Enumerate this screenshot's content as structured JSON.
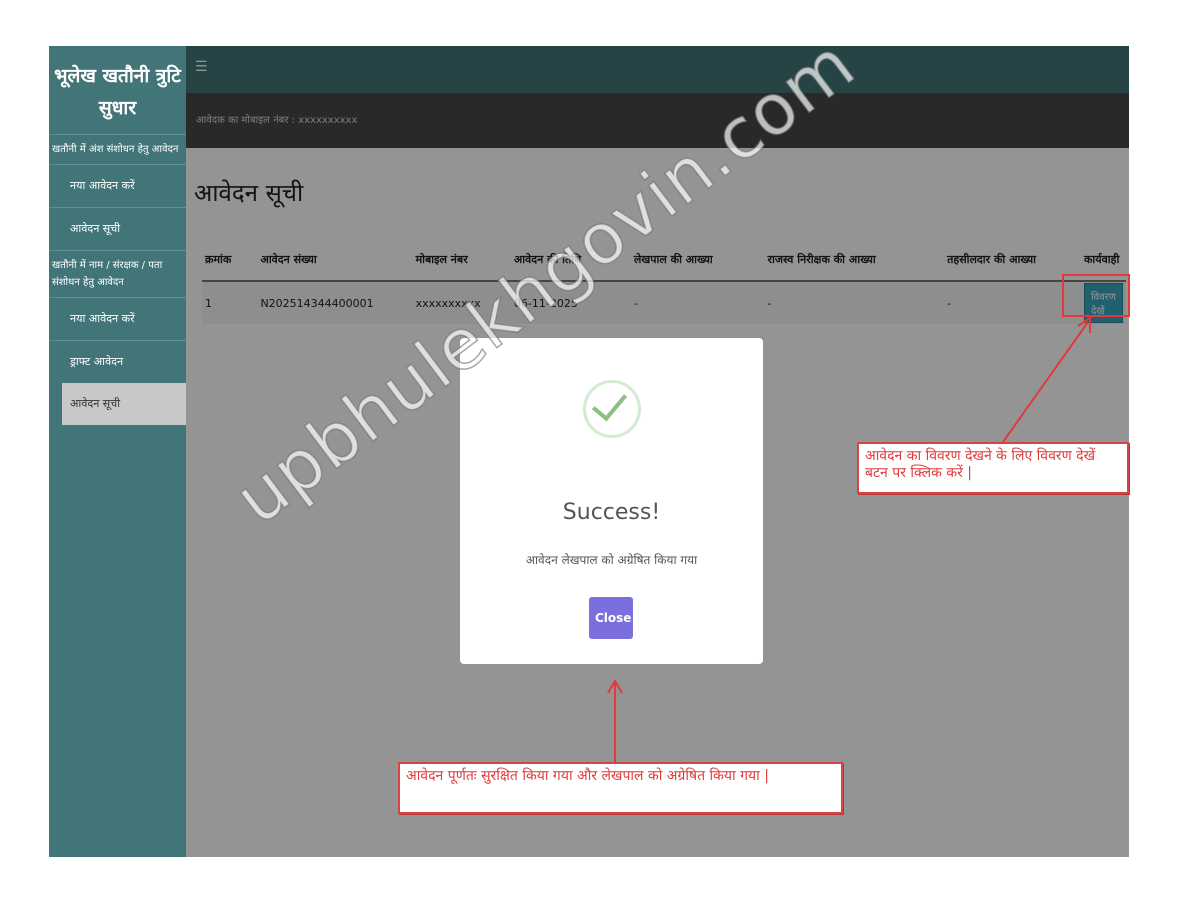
{
  "sidebar": {
    "brand": "भूलेख खतौनी त्रुटि सुधार",
    "section1": "खतौनी में अंश संशोधन हेतु आवेदन",
    "section1_items": [
      "नया आवेदन करें",
      "आवेदन सूची"
    ],
    "section2": "खतौनी में नाम / संरक्षक / पता संशोधन हेतु आवेदन",
    "section2_items": [
      "नया आवेदन करें",
      "ड्राफ्ट आवेदन",
      "आवेदन सूची"
    ]
  },
  "header": {
    "menu_icon": "list-icon",
    "mobile_label": "आवेदक का मोबाइल नंबर : xxxxxxxxxx"
  },
  "main": {
    "title": "आवेदन सूची",
    "columns": [
      "क्रमांक",
      "आवेदन संख्या",
      "मोबाइल नंबर",
      "आवेदन की तिथि",
      "लेखपाल की आख्या",
      "राजस्व निरीक्षक की आख्या",
      "तहसीलदार की आख्या",
      "कार्यवाही"
    ],
    "rows": [
      {
        "sno": "1",
        "app_no": "N202514344400001",
        "mobile": "xxxxxxxxxx",
        "date": "06-11-2025",
        "lekhpal": "-",
        "rajasv": "-",
        "tehsildar": "-",
        "action": "विवरण देखें"
      }
    ]
  },
  "modal": {
    "title": "Success!",
    "message": "आवेदन लेखपाल को अग्रेषित किया गया",
    "close": "Close"
  },
  "annotations": {
    "view_hint": "आवेदन का विवरण देखने के लिए विवरण देखें बटन पर क्लिक करें |",
    "success_hint": "आवेदन पूर्णतः सुरक्षित किया गया और लेखपाल को अग्रेषित किया गया |"
  },
  "watermark": "upbhulekhgovin.com",
  "colors": {
    "sidebar": "#427577",
    "subheader": "#474747",
    "action_button": "#3aa8c0",
    "close_button": "#7a6fdc",
    "annotation": "#e03a3a"
  }
}
